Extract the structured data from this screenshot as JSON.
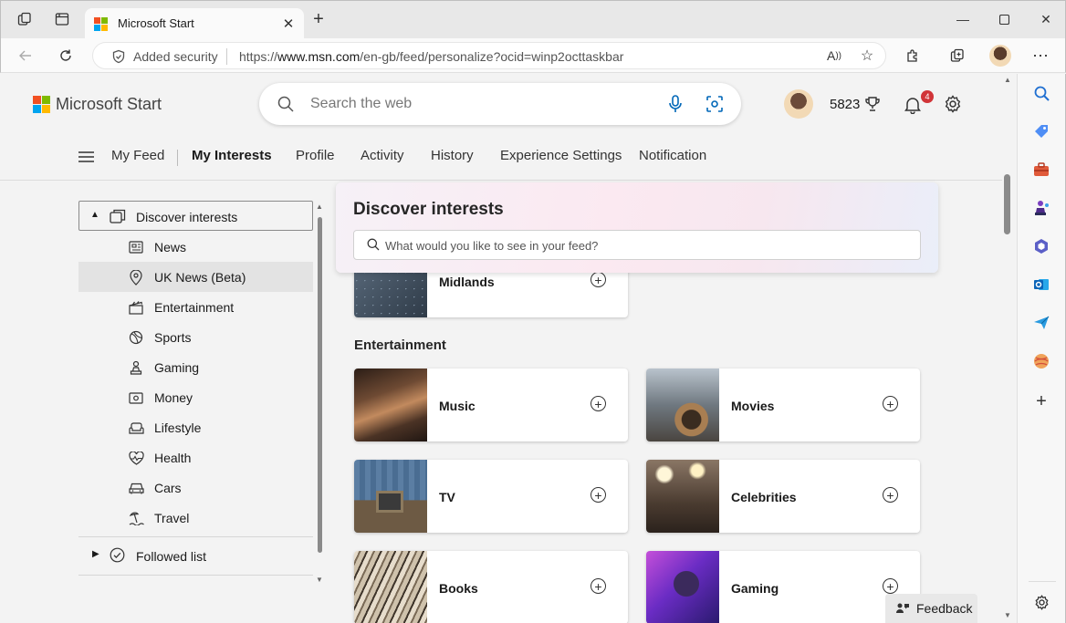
{
  "browser": {
    "tab_title": "Microsoft Start",
    "security_label": "Added security",
    "url_prefix": "https://",
    "url_host": "www.msn.com",
    "url_path": "/en-gb/feed/personalize?ocid=winp2octtaskbar"
  },
  "header": {
    "brand": "Microsoft Start",
    "search_placeholder": "Search the web",
    "points": "5823",
    "notification_count": "4"
  },
  "nav": {
    "items": [
      "My Feed",
      "My Interests",
      "Profile",
      "Activity",
      "History",
      "Experience Settings",
      "Notification"
    ],
    "active": "My Interests"
  },
  "sidebar": {
    "discover_label": "Discover interests",
    "items": [
      "News",
      "UK News (Beta)",
      "Entertainment",
      "Sports",
      "Gaming",
      "Money",
      "Lifestyle",
      "Health",
      "Cars",
      "Travel"
    ],
    "selected": "UK News (Beta)",
    "followed_label": "Followed list"
  },
  "main": {
    "discover_title": "Discover interests",
    "discover_placeholder": "What would you like to see in your feed?",
    "midlands_tile": "Midlands",
    "entertainment_title": "Entertainment",
    "tiles": [
      "Music",
      "Movies",
      "TV",
      "Celebrities",
      "Books",
      "Gaming"
    ],
    "feedback_label": "Feedback"
  },
  "colors": {
    "ms_red": "#f25022",
    "ms_green": "#7fba00",
    "ms_blue": "#00a4ef",
    "ms_yellow": "#ffb900",
    "badge": "#d13438"
  }
}
